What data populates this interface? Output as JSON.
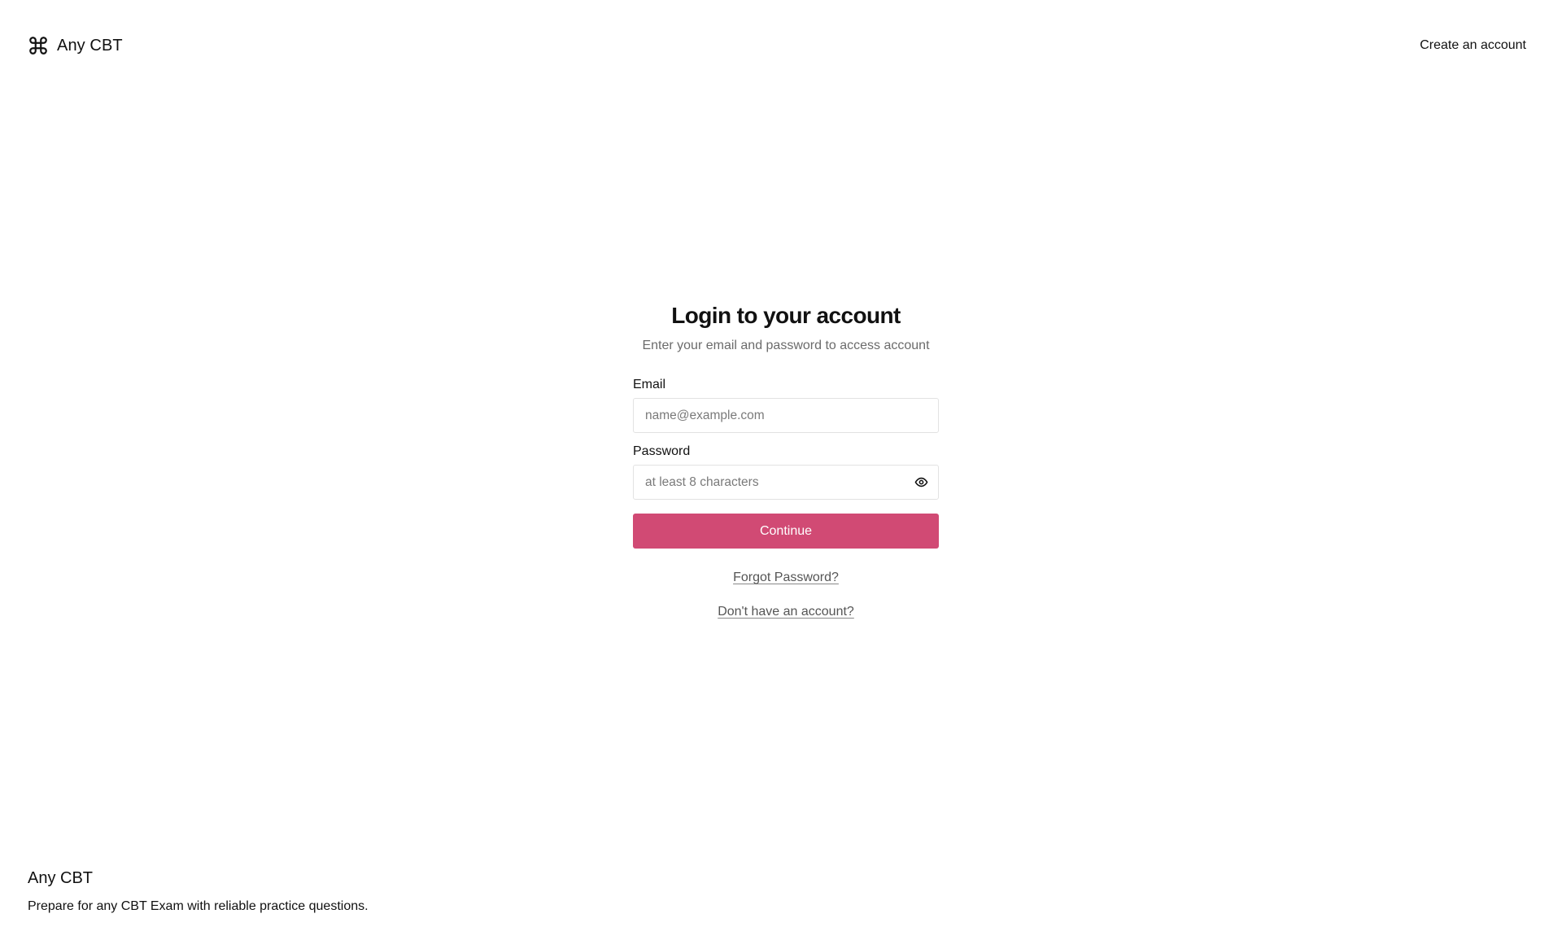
{
  "header": {
    "brand_icon": "command-icon",
    "brand_name": "Any CBT",
    "create_account_label": "Create an account"
  },
  "login": {
    "title": "Login to your account",
    "subtitle": "Enter your email and password to access account",
    "email_label": "Email",
    "email_placeholder": "name@example.com",
    "email_value": "",
    "password_label": "Password",
    "password_placeholder": "at least 8 characters",
    "password_value": "",
    "password_toggle_icon": "eye-icon",
    "continue_label": "Continue",
    "forgot_password_label": "Forgot Password?",
    "no_account_label": "Don't have an account?"
  },
  "footer": {
    "title": "Any CBT",
    "tagline": "Prepare for any CBT Exam with reliable practice questions."
  },
  "colors": {
    "accent": "#d14a74",
    "text": "#111111",
    "muted": "#6b6b6b",
    "border": "#e2e2e2"
  }
}
